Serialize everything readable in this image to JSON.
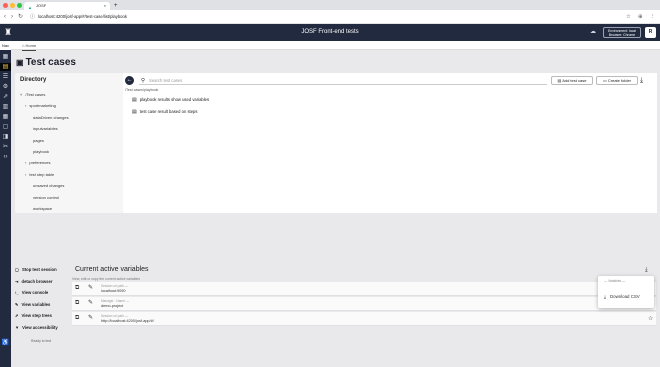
{
  "browser": {
    "tab_title": "JOSF",
    "url": "localhost:4200/josf-app/#/test-case/list/playbook"
  },
  "app": {
    "title": "JOSF Front-end tests",
    "environment_line1": "Environment: local",
    "environment_line2": "Browser: Chrome",
    "avatar": "R",
    "sidebar_toggle": "Nav"
  },
  "breadcrumb": {
    "home": "Home"
  },
  "page": {
    "title": "Test cases"
  },
  "directory": {
    "heading": "Directory",
    "root": "/Test cases",
    "items": [
      {
        "label": "sportmarketing",
        "expandable": true
      },
      {
        "label": "dataDriven changes",
        "expandable": false
      },
      {
        "label": "inputvariables",
        "expandable": false
      },
      {
        "label": "pages",
        "expandable": false
      },
      {
        "label": "playbook",
        "expandable": false
      },
      {
        "label": "preferences",
        "expandable": true
      },
      {
        "label": "test step table",
        "expandable": true
      },
      {
        "label": "unsaved changes",
        "expandable": false
      },
      {
        "label": "version control",
        "expandable": false
      },
      {
        "label": "workspace",
        "expandable": false
      }
    ]
  },
  "toolbar": {
    "search_placeholder": "Search test cases",
    "add_test_case": "Add test case",
    "create_folder": "Create folder"
  },
  "listing": {
    "path": "/Test cases/playbook",
    "test_cases": [
      "playbook results show used variables",
      "test case result based on steps"
    ]
  },
  "session": {
    "stop": "Stop test session",
    "detach": "detach browser",
    "console": "View console",
    "variables": "View variables",
    "steps": "View step trees",
    "accessibility": "View accessibility",
    "status": "Ready to test"
  },
  "variables": {
    "heading": "Current active variables",
    "subtitle": "View, edit or copy the current active variables",
    "rows": [
      {
        "key": "Session url path —",
        "value": "localhost:9090"
      },
      {
        "key": "Manager - Name —",
        "value": "demo-project"
      },
      {
        "key": "Session url path —",
        "value": "http://localhost:4200/josf-app/#/"
      }
    ]
  },
  "menu": {
    "header": "— Variables —",
    "download_csv": "Download CSV"
  }
}
